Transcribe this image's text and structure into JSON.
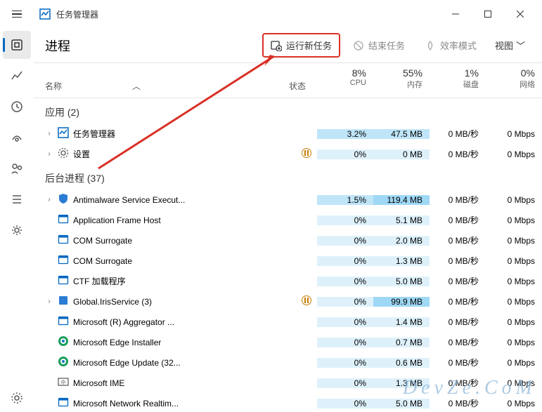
{
  "window": {
    "title": "任务管理器"
  },
  "header": {
    "title": "进程",
    "run_new_task": "运行新任务",
    "end_task": "结束任务",
    "efficiency_mode": "效率模式",
    "view": "视图"
  },
  "columns": {
    "name": "名称",
    "status": "状态",
    "cpu": {
      "pct": "8%",
      "label": "CPU"
    },
    "memory": {
      "pct": "55%",
      "label": "内存"
    },
    "disk": {
      "pct": "1%",
      "label": "磁盘"
    },
    "network": {
      "pct": "0%",
      "label": "网络"
    }
  },
  "groups": {
    "apps": "应用 (2)",
    "background": "后台进程 (37)"
  },
  "rows": [
    {
      "expand": true,
      "icon": "task-manager",
      "name": "任务管理器",
      "status": "",
      "cpu": "3.2%",
      "cpu_h": 2,
      "mem": "47.5 MB",
      "mem_h": 2,
      "disk": "0 MB/秒",
      "net": "0 Mbps"
    },
    {
      "expand": true,
      "icon": "settings",
      "name": "设置",
      "status": "pause",
      "cpu": "0%",
      "cpu_h": 1,
      "mem": "0 MB",
      "mem_h": 1,
      "disk": "0 MB/秒",
      "net": "0 Mbps"
    },
    {
      "expand": true,
      "icon": "shield",
      "name": "Antimalware Service Execut...",
      "status": "",
      "cpu": "1.5%",
      "cpu_h": 2,
      "mem": "119.4 MB",
      "mem_h": 3,
      "disk": "0 MB/秒",
      "net": "0 Mbps"
    },
    {
      "expand": false,
      "icon": "app",
      "name": "Application Frame Host",
      "status": "",
      "cpu": "0%",
      "cpu_h": 1,
      "mem": "5.1 MB",
      "mem_h": 1,
      "disk": "0 MB/秒",
      "net": "0 Mbps"
    },
    {
      "expand": false,
      "icon": "app",
      "name": "COM Surrogate",
      "status": "",
      "cpu": "0%",
      "cpu_h": 1,
      "mem": "2.0 MB",
      "mem_h": 1,
      "disk": "0 MB/秒",
      "net": "0 Mbps"
    },
    {
      "expand": false,
      "icon": "app",
      "name": "COM Surrogate",
      "status": "",
      "cpu": "0%",
      "cpu_h": 1,
      "mem": "1.3 MB",
      "mem_h": 1,
      "disk": "0 MB/秒",
      "net": "0 Mbps"
    },
    {
      "expand": false,
      "icon": "app",
      "name": "CTF 加载程序",
      "status": "",
      "cpu": "0%",
      "cpu_h": 1,
      "mem": "5.0 MB",
      "mem_h": 1,
      "disk": "0 MB/秒",
      "net": "0 Mbps"
    },
    {
      "expand": true,
      "icon": "iris",
      "name": "Global.IrisService (3)",
      "status": "pause",
      "cpu": "0%",
      "cpu_h": 1,
      "mem": "99.9 MB",
      "mem_h": 3,
      "disk": "0 MB/秒",
      "net": "0 Mbps"
    },
    {
      "expand": false,
      "icon": "app",
      "name": "Microsoft (R) Aggregator ...",
      "status": "",
      "cpu": "0%",
      "cpu_h": 1,
      "mem": "1.4 MB",
      "mem_h": 1,
      "disk": "0 MB/秒",
      "net": "0 Mbps"
    },
    {
      "expand": false,
      "icon": "edge",
      "name": "Microsoft Edge Installer",
      "status": "",
      "cpu": "0%",
      "cpu_h": 1,
      "mem": "0.7 MB",
      "mem_h": 1,
      "disk": "0 MB/秒",
      "net": "0 Mbps"
    },
    {
      "expand": false,
      "icon": "edge",
      "name": "Microsoft Edge Update (32...",
      "status": "",
      "cpu": "0%",
      "cpu_h": 1,
      "mem": "0.6 MB",
      "mem_h": 1,
      "disk": "0 MB/秒",
      "net": "0 Mbps"
    },
    {
      "expand": false,
      "icon": "ime",
      "name": "Microsoft IME",
      "status": "",
      "cpu": "0%",
      "cpu_h": 1,
      "mem": "1.3 MB",
      "mem_h": 1,
      "disk": "0 MB/秒",
      "net": "0 Mbps"
    },
    {
      "expand": false,
      "icon": "app",
      "name": "Microsoft Network Realtim...",
      "status": "",
      "cpu": "0%",
      "cpu_h": 1,
      "mem": "5.0 MB",
      "mem_h": 1,
      "disk": "0 MB/秒",
      "net": "0 Mbps"
    }
  ],
  "watermark": "DevZe.CoM"
}
